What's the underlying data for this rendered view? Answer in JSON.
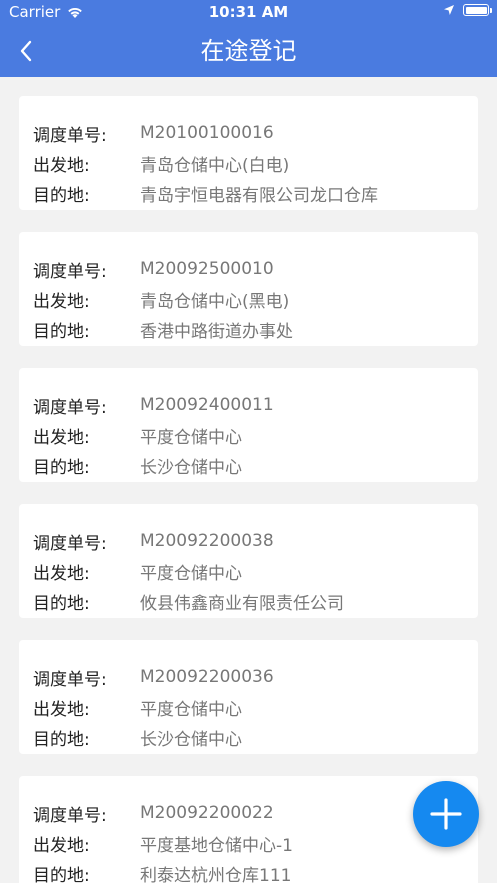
{
  "status_bar": {
    "carrier": "Carrier",
    "time": "10:31 AM",
    "battery_level": 1.0
  },
  "navbar": {
    "title": "在途登记",
    "back_icon": "chevron-left-icon"
  },
  "labels": {
    "dispatch_no": "调度单号:",
    "origin": "出发地:",
    "destination": "目的地:"
  },
  "records": [
    {
      "dispatch_no": "M20100100016",
      "origin": "青岛仓储中心(白电)",
      "destination": "青岛宇恒电器有限公司龙口仓库"
    },
    {
      "dispatch_no": "M20092500010",
      "origin": "青岛仓储中心(黑电)",
      "destination": "香港中路街道办事处"
    },
    {
      "dispatch_no": "M20092400011",
      "origin": "平度仓储中心",
      "destination": "长沙仓储中心"
    },
    {
      "dispatch_no": "M20092200038",
      "origin": "平度仓储中心",
      "destination": "攸县伟鑫商业有限责任公司"
    },
    {
      "dispatch_no": "M20092200036",
      "origin": "平度仓储中心",
      "destination": "长沙仓储中心"
    },
    {
      "dispatch_no": "M20092200022",
      "origin": "平度基地仓储中心-1",
      "destination": "利泰达杭州仓库111"
    }
  ],
  "fab": {
    "icon": "plus-icon"
  },
  "colors": {
    "primary": "#4a7be0",
    "fab": "#1589f0",
    "background": "#f2f2f2"
  }
}
